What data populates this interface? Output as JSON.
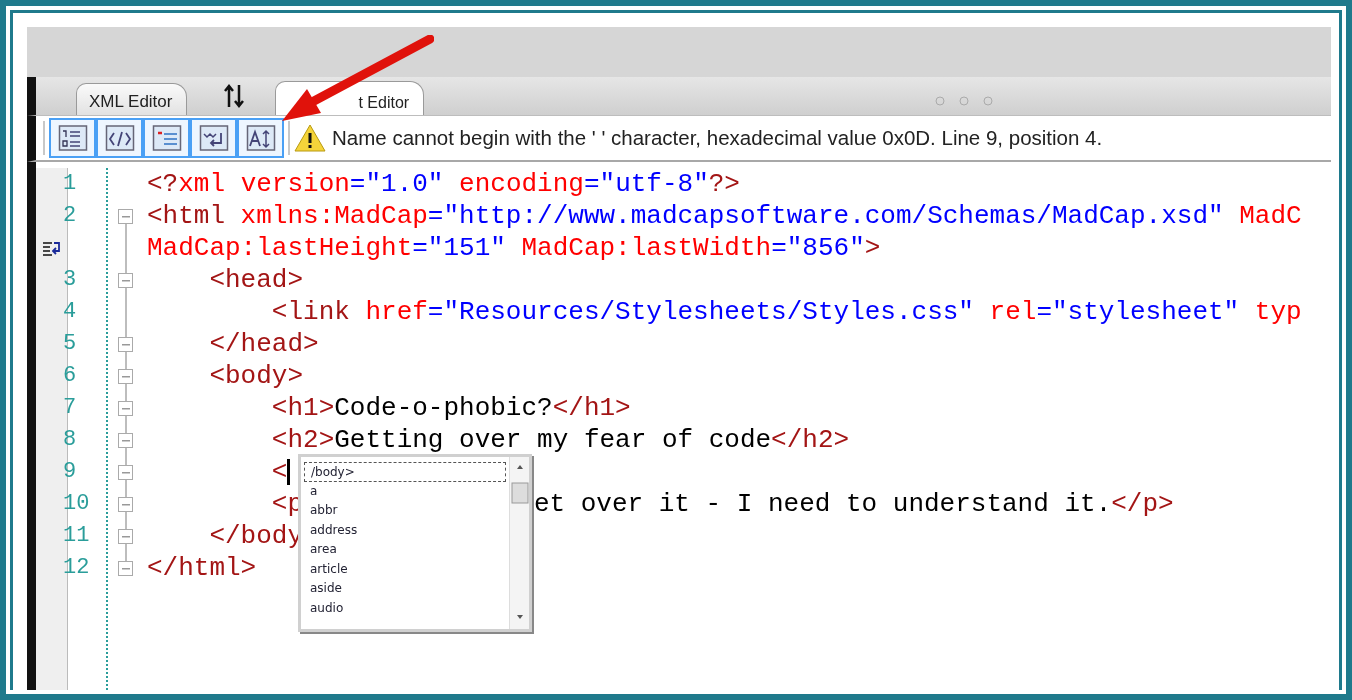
{
  "tabs": [
    {
      "label": "XML Editor",
      "selected": false
    },
    {
      "label": "t Editor",
      "selected": true
    }
  ],
  "message": "Name cannot begin with the ' ' character, hexadecimal value 0x0D. Line 9, position 4.",
  "lines": [
    {
      "number": "1",
      "fold": false,
      "segments": [
        {
          "kind": "delim",
          "text": "<?"
        },
        {
          "kind": "attr",
          "text": "xml version"
        },
        {
          "kind": "value",
          "text": "=\"1.0\""
        },
        {
          "kind": "attr",
          "text": " encoding"
        },
        {
          "kind": "value",
          "text": "=\"utf-8\""
        },
        {
          "kind": "delim",
          "text": "?>"
        }
      ]
    },
    {
      "number": "2",
      "fold": true,
      "segments": [
        {
          "kind": "delim",
          "text": "<html"
        },
        {
          "kind": "attr",
          "text": " xmlns:MadCap"
        },
        {
          "kind": "value",
          "text": "=\"http://www.madcapsoftware.com/Schemas/MadCap.xsd\""
        },
        {
          "kind": "attr",
          "text": " MadC"
        }
      ],
      "wrap": [
        {
          "kind": "attr",
          "text": "MadCap:lastHeight"
        },
        {
          "kind": "value",
          "text": "=\"151\""
        },
        {
          "kind": "attr",
          "text": " MadCap:lastWidth"
        },
        {
          "kind": "value",
          "text": "=\"856\""
        },
        {
          "kind": "delim",
          "text": ">"
        }
      ]
    },
    {
      "number": "3",
      "fold": true,
      "segments": [
        {
          "kind": "delim",
          "text": "    <head>"
        }
      ]
    },
    {
      "number": "4",
      "fold": false,
      "segments": [
        {
          "kind": "delim",
          "text": "        <link"
        },
        {
          "kind": "attr",
          "text": " href"
        },
        {
          "kind": "value",
          "text": "=\"Resources/Stylesheets/Styles.css\""
        },
        {
          "kind": "attr",
          "text": " rel"
        },
        {
          "kind": "value",
          "text": "=\"stylesheet\""
        },
        {
          "kind": "attr",
          "text": " typ"
        }
      ]
    },
    {
      "number": "5",
      "fold": true,
      "segments": [
        {
          "kind": "delim",
          "text": "    </head>"
        }
      ]
    },
    {
      "number": "6",
      "fold": true,
      "segments": [
        {
          "kind": "delim",
          "text": "    <body>"
        }
      ]
    },
    {
      "number": "7",
      "fold": true,
      "segments": [
        {
          "kind": "delim",
          "text": "        <h1>"
        },
        {
          "kind": "text",
          "text": "Code-o-phobic?"
        },
        {
          "kind": "delim",
          "text": "</h1>"
        }
      ]
    },
    {
      "number": "8",
      "fold": true,
      "segments": [
        {
          "kind": "delim",
          "text": "        <h2>"
        },
        {
          "kind": "text",
          "text": "Getting over my fear of code"
        },
        {
          "kind": "delim",
          "text": "</h2>"
        }
      ]
    },
    {
      "number": "9",
      "fold": true,
      "segments": [
        {
          "kind": "delim",
          "text": "        <"
        },
        {
          "kind": "cursor"
        }
      ]
    },
    {
      "number": "10",
      "fold": true,
      "segments": [
        {
          "kind": "delim",
          "text": "        <p"
        },
        {
          "kind": "text",
          "text": "et over it - I need to understand it.",
          "after_popup": true
        },
        {
          "kind": "delim",
          "text": "</p>"
        }
      ]
    },
    {
      "number": "11",
      "fold": true,
      "segments": [
        {
          "kind": "delim",
          "text": "    </body"
        }
      ]
    },
    {
      "number": "12",
      "fold": true,
      "segments": [
        {
          "kind": "delim",
          "text": "</html>"
        }
      ]
    }
  ],
  "completion": {
    "items": [
      {
        "label": "/body>",
        "selected": true
      },
      {
        "label": "a",
        "selected": false
      },
      {
        "label": "abbr",
        "selected": false
      },
      {
        "label": "address",
        "selected": false
      },
      {
        "label": "area",
        "selected": false
      },
      {
        "label": "article",
        "selected": false
      },
      {
        "label": "aside",
        "selected": false
      },
      {
        "label": "audio",
        "selected": false
      }
    ]
  }
}
